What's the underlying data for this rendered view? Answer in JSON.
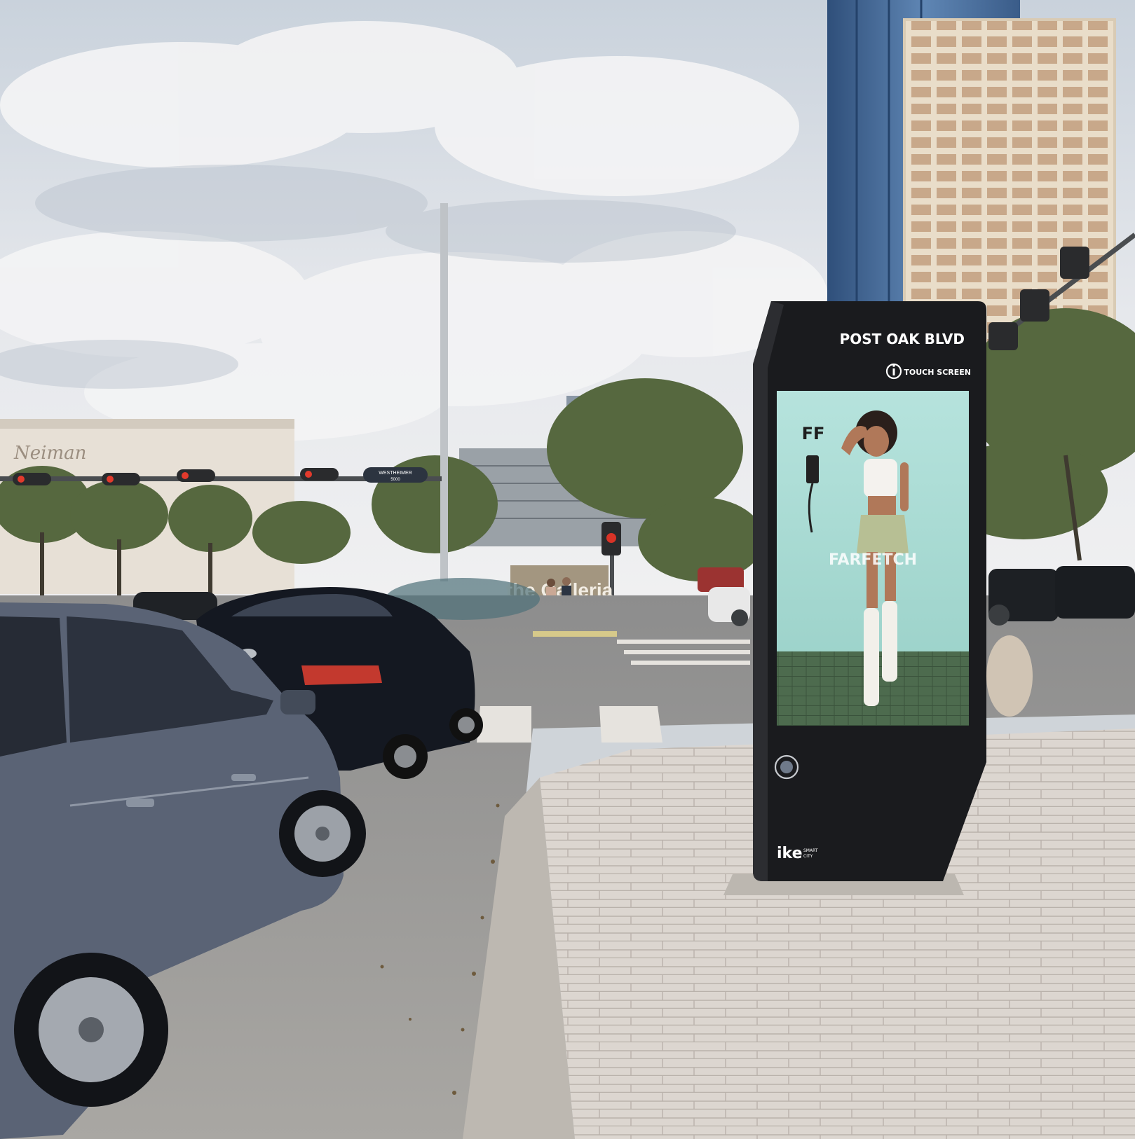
{
  "kiosk": {
    "street_name": "POST OAK BLVD",
    "touch_hint": "TOUCH SCREEN",
    "info_icon": "info-icon",
    "brand_main": "ike",
    "brand_sub_1": "SMART",
    "brand_sub_2": "CITY"
  },
  "advert": {
    "brand": "FARFETCH",
    "monogram": "FF"
  },
  "street_sign": {
    "line1": "WESTHEIMER",
    "line2": "5000"
  },
  "galleria_sign": {
    "text": "the Galleria"
  },
  "colors": {
    "sky": "#dfe3e8",
    "kiosk_body": "#1a1b1e",
    "advert_bg": "#a9ddd6",
    "sidewalk": "#d9d2cc"
  }
}
